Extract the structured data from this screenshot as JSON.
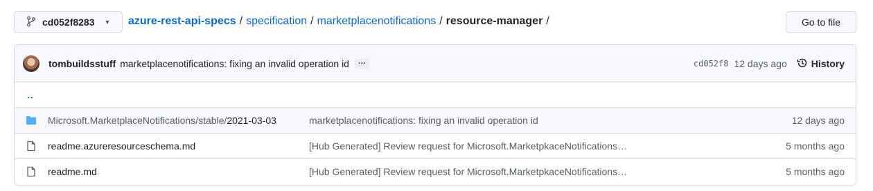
{
  "branch": {
    "name": "cd052f8283"
  },
  "breadcrumb": {
    "repo": "azure-rest-api-specs",
    "segments": [
      "specification",
      "marketplacenotifications"
    ],
    "current": "resource-manager",
    "separator": "/"
  },
  "actions": {
    "go_to_file": "Go to file"
  },
  "latest_commit": {
    "author": "tombuildsstuff",
    "message": "marketplacenotifications: fixing an invalid operation id",
    "ellipsis": "…",
    "sha": "cd052f8",
    "age": "12 days ago",
    "history_label": "History"
  },
  "parent_link": "..",
  "files": [
    {
      "type": "folder",
      "name_prefix": "Microsoft.MarketplaceNotifications/stable/",
      "name_suffix": "2021-03-03",
      "message": "marketplacenotifications: fixing an invalid operation id",
      "age": "12 days ago"
    },
    {
      "type": "file",
      "name": "readme.azureresourceschema.md",
      "message": "[Hub Generated] Review request for Microsoft.MarketpkaceNotifications…",
      "age": "5 months ago"
    },
    {
      "type": "file",
      "name": "readme.md",
      "message": "[Hub Generated] Review request for Microsoft.MarketpkaceNotifications…",
      "age": "5 months ago"
    }
  ],
  "colors": {
    "link": "#0969da",
    "folder": "#54aeff",
    "muted": "#57606a",
    "border": "#d0d7de"
  }
}
